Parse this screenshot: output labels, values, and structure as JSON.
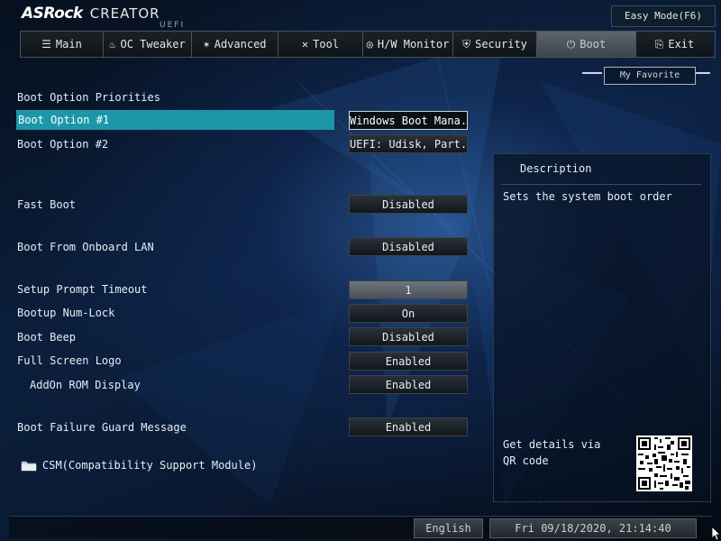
{
  "brand": {
    "name": "ASRock",
    "product": "CREATOR",
    "suffix": "UEFI"
  },
  "easy_mode_label": "Easy Mode(F6)",
  "tabs": [
    {
      "label": "Main",
      "icon": "list-icon"
    },
    {
      "label": "OC Tweaker",
      "icon": "flame-icon"
    },
    {
      "label": "Advanced",
      "icon": "star-icon"
    },
    {
      "label": "Tool",
      "icon": "tools-icon"
    },
    {
      "label": "H/W Monitor",
      "icon": "monitor-icon"
    },
    {
      "label": "Security",
      "icon": "shield-icon"
    },
    {
      "label": "Boot",
      "icon": "power-icon",
      "active": true
    },
    {
      "label": "Exit",
      "icon": "exit-icon"
    }
  ],
  "favorite_label": "My Favorite",
  "section_title": "Boot Option Priorities",
  "settings": [
    {
      "label": "Boot Option #1",
      "value": "Windows Boot Mana...",
      "highlighted": true
    },
    {
      "label": "Boot Option #2",
      "value": "UEFI: Udisk, Part..."
    },
    {
      "label": "Fast Boot",
      "value": "Disabled"
    },
    {
      "label": "Boot From Onboard LAN",
      "value": "Disabled"
    },
    {
      "label": "Setup Prompt Timeout",
      "value": "1"
    },
    {
      "label": "Bootup Num-Lock",
      "value": "On"
    },
    {
      "label": "Boot Beep",
      "value": "Disabled"
    },
    {
      "label": "Full Screen Logo",
      "value": "Enabled"
    },
    {
      "label": "AddOn ROM Display",
      "value": "Enabled"
    },
    {
      "label": "Boot Failure Guard Message",
      "value": "Enabled"
    }
  ],
  "csm_label": "CSM(Compatibility Support Module)",
  "description": {
    "title": "Description",
    "text": "Sets the system boot order",
    "qr_text": "Get details via QR code"
  },
  "footer": {
    "language": "English",
    "datetime": "Fri 09/18/2020, 21:14:40"
  },
  "colors": {
    "highlight": "#1c97aa",
    "active_tab": "#4d555c"
  }
}
